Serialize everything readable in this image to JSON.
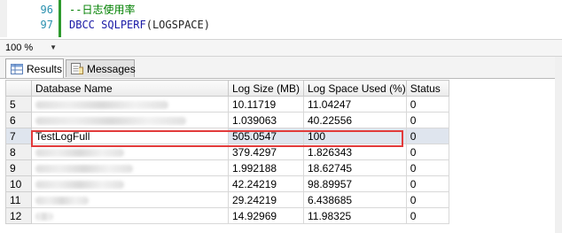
{
  "editor": {
    "lines": [
      {
        "line_no": "96",
        "comment": "--日志使用率"
      },
      {
        "line_no": "97",
        "keyword1": "DBCC",
        "keyword2": "SQLPERF",
        "arg": "(LOGSPACE)"
      }
    ]
  },
  "zoom": {
    "value": "100 %"
  },
  "tabs": [
    {
      "label": "Results",
      "icon": "grid-icon"
    },
    {
      "label": "Messages",
      "icon": "messages-icon"
    }
  ],
  "grid": {
    "columns": [
      "Database Name",
      "Log Size (MB)",
      "Log Space Used (%)",
      "Status"
    ],
    "rows": [
      {
        "num": "5",
        "name": "",
        "log_size": "10.11719",
        "used": "11.04247",
        "status": "0"
      },
      {
        "num": "6",
        "name": "",
        "log_size": "1.039063",
        "used": "40.22556",
        "status": "0"
      },
      {
        "num": "7",
        "name": "TestLogFull",
        "log_size": "505.0547",
        "used": "100",
        "status": "0"
      },
      {
        "num": "8",
        "name": "",
        "log_size": "379.4297",
        "used": "1.826343",
        "status": "0"
      },
      {
        "num": "9",
        "name": "",
        "log_size": "1.992188",
        "used": "18.62745",
        "status": "0"
      },
      {
        "num": "10",
        "name": "",
        "log_size": "42.24219",
        "used": "98.89957",
        "status": "0"
      },
      {
        "num": "11",
        "name": "",
        "log_size": "29.24219",
        "used": "6.438685",
        "status": "0"
      },
      {
        "num": "12",
        "name": "",
        "log_size": "14.92969",
        "used": "11.98325",
        "status": "0"
      }
    ],
    "highlight_color": "#e23b3b",
    "selected_row_color": "#dfe5ee"
  }
}
